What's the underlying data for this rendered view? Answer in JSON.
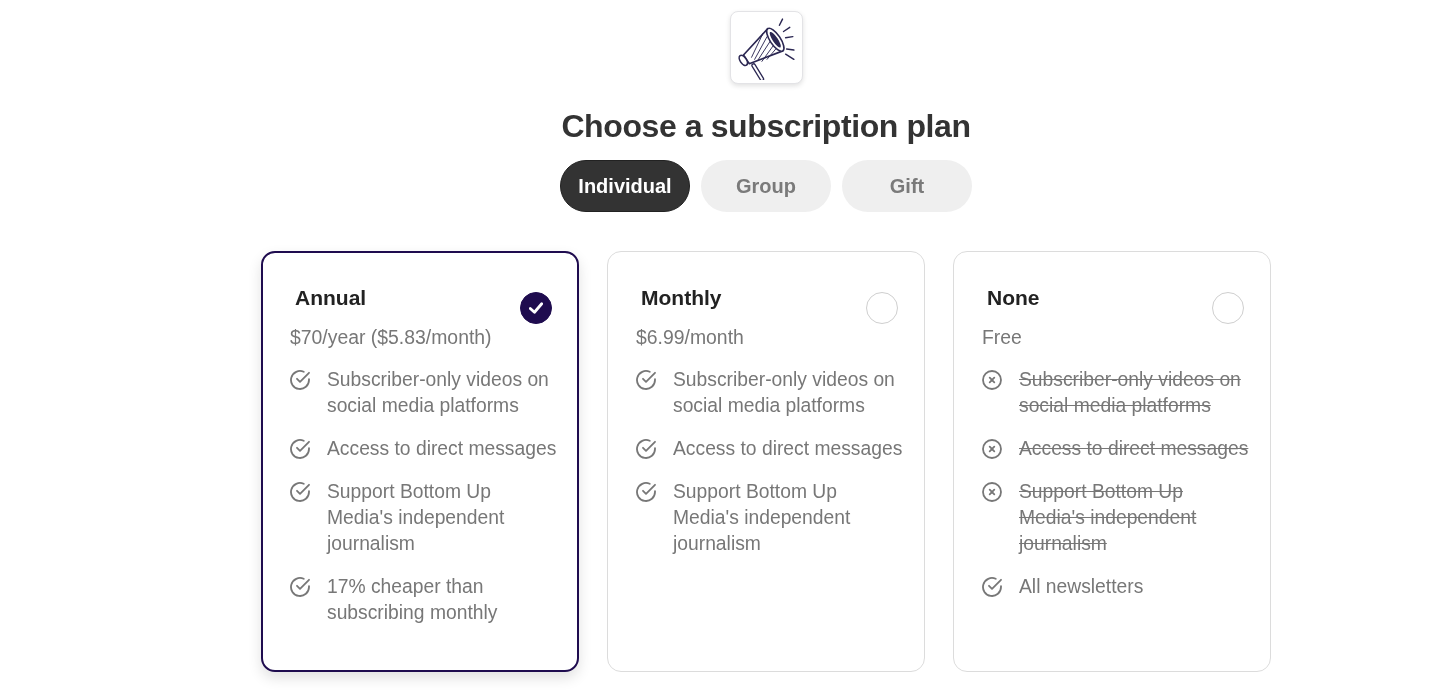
{
  "heading": "Choose a subscription plan",
  "tabs": [
    {
      "label": "Individual",
      "selected": true
    },
    {
      "label": "Group",
      "selected": false
    },
    {
      "label": "Gift",
      "selected": false
    }
  ],
  "plans": [
    {
      "name": "Annual",
      "price": "$70/year ($5.83/month)",
      "selected": true,
      "features": [
        {
          "text": "Subscriber-only videos on social media platforms",
          "included": true
        },
        {
          "text": "Access to direct messages",
          "included": true
        },
        {
          "text": "Support Bottom Up Media's independent journalism",
          "included": true
        },
        {
          "text": "17% cheaper than subscribing monthly",
          "included": true
        }
      ]
    },
    {
      "name": "Monthly",
      "price": "$6.99/month",
      "selected": false,
      "features": [
        {
          "text": "Subscriber-only videos on social media platforms",
          "included": true
        },
        {
          "text": "Access to direct messages",
          "included": true
        },
        {
          "text": "Support Bottom Up Media's independent journalism",
          "included": true
        }
      ]
    },
    {
      "name": "None",
      "price": "Free",
      "selected": false,
      "features": [
        {
          "text": "Subscriber-only videos on social media platforms",
          "included": false
        },
        {
          "text": "Access to direct messages",
          "included": false
        },
        {
          "text": "Support Bottom Up Media's independent journalism",
          "included": false
        },
        {
          "text": "All newsletters",
          "included": true
        }
      ]
    }
  ]
}
